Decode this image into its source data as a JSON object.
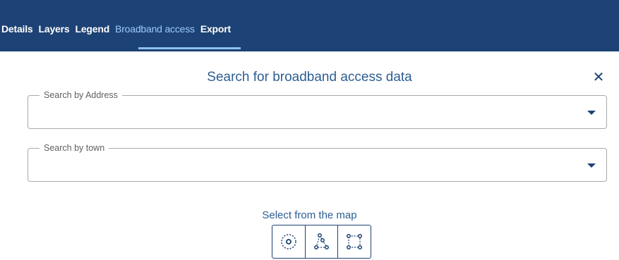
{
  "nav": {
    "tabs": [
      {
        "label": "Details"
      },
      {
        "label": "Layers"
      },
      {
        "label": "Legend"
      },
      {
        "label": "Broadband access",
        "active": true
      },
      {
        "label": "Export"
      }
    ]
  },
  "panel": {
    "title": "Search for broadband access data",
    "close_icon": "close-icon",
    "address_field": {
      "label": "Search by Address",
      "value": ""
    },
    "town_field": {
      "label": "Search by town",
      "value": ""
    },
    "map_select_label": "Select from the map",
    "map_tools": [
      {
        "icon": "circle-select-icon"
      },
      {
        "icon": "polygon-select-icon"
      },
      {
        "icon": "rectangle-select-icon"
      }
    ]
  },
  "colors": {
    "header_bg": "#1d4275",
    "active_tab": "#9ccaf5",
    "title_text": "#2d5e92"
  }
}
